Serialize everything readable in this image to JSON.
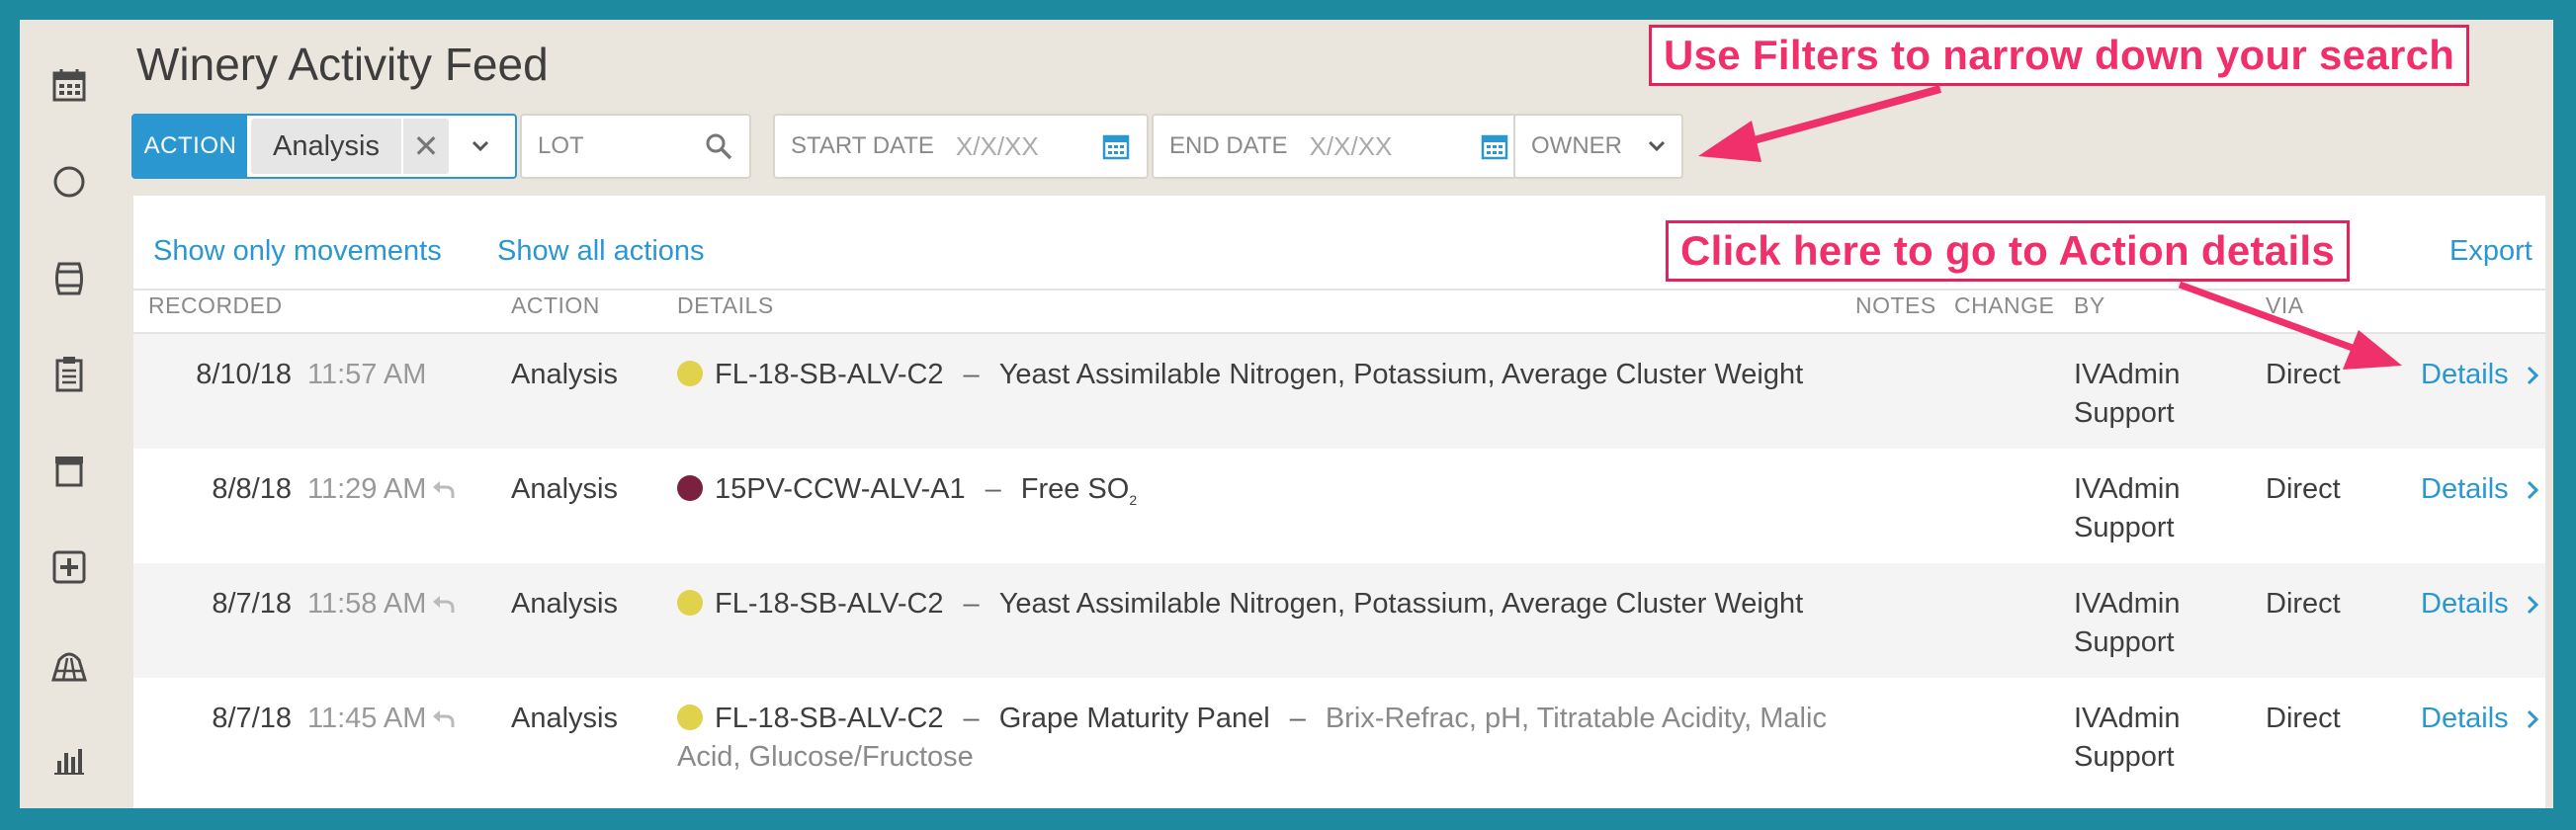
{
  "sidebar": {
    "icons": [
      "calendar-icon",
      "circle-icon",
      "barrel-icon",
      "clipboard-icon",
      "archive-icon",
      "plus-box-icon",
      "vineyard-icon",
      "bar-chart-icon"
    ]
  },
  "page": {
    "title": "Winery Activity Feed"
  },
  "filters": {
    "action": {
      "tag": "ACTION",
      "selected": "Analysis",
      "clear": "✕"
    },
    "lot": {
      "placeholder": "LOT"
    },
    "start_date": {
      "label": "START DATE",
      "placeholder": "X/X/XX"
    },
    "end_date": {
      "label": "END DATE",
      "placeholder": "X/X/XX"
    },
    "owner": {
      "label": "OWNER"
    }
  },
  "card": {
    "links": {
      "movements": "Show only movements",
      "all_actions": "Show all actions",
      "export": "Export"
    },
    "columns": {
      "recorded": "RECORDED",
      "action": "ACTION",
      "details": "DETAILS",
      "notes": "NOTES",
      "change": "CHANGE",
      "by": "BY",
      "via": "VIA"
    }
  },
  "rows": [
    {
      "date": "8/10/18",
      "time": "11:57 AM",
      "undo": false,
      "action": "Analysis",
      "dot_color": "#e0d24c",
      "lot": "FL-18-SB-ALV-C2",
      "sep": "–",
      "detail": "Yeast Assimilable Nitrogen, Potassium, Average Cluster Weight",
      "by_line1": "IVAdmin",
      "by_line2": "Support",
      "via": "Direct",
      "link": "Details"
    },
    {
      "date": "8/8/18",
      "time": "11:29 AM",
      "undo": true,
      "action": "Analysis",
      "dot_color": "#7a2140",
      "lot": "15PV-CCW-ALV-A1",
      "sep": "–",
      "detail": "Free SO",
      "detail_sub": "2",
      "by_line1": "IVAdmin",
      "by_line2": "Support",
      "via": "Direct",
      "link": "Details"
    },
    {
      "date": "8/7/18",
      "time": "11:58 AM",
      "undo": true,
      "action": "Analysis",
      "dot_color": "#e0d24c",
      "lot": "FL-18-SB-ALV-C2",
      "sep": "–",
      "detail": "Yeast Assimilable Nitrogen, Potassium, Average Cluster Weight",
      "by_line1": "IVAdmin",
      "by_line2": "Support",
      "via": "Direct",
      "link": "Details"
    },
    {
      "date": "8/7/18",
      "time": "11:45 AM",
      "undo": true,
      "action": "Analysis",
      "dot_color": "#e0d24c",
      "lot": "FL-18-SB-ALV-C2",
      "sep": "–",
      "detail": "Grape Maturity Panel",
      "detail_extra": "Brix-Refrac, pH, Titratable Acidity, Malic",
      "detail_extra2": "Acid, Glucose/Fructose",
      "by_line1": "IVAdmin",
      "by_line2": "Support",
      "via": "Direct",
      "link": "Details"
    }
  ],
  "callouts": {
    "filters": "Use Filters to narrow down your search",
    "details": "Click here to go to Action details"
  },
  "colors": {
    "accent": "#2a97d0",
    "callout": "#f0306b",
    "frame": "#1e8aa0",
    "background": "#ebe6dd"
  }
}
